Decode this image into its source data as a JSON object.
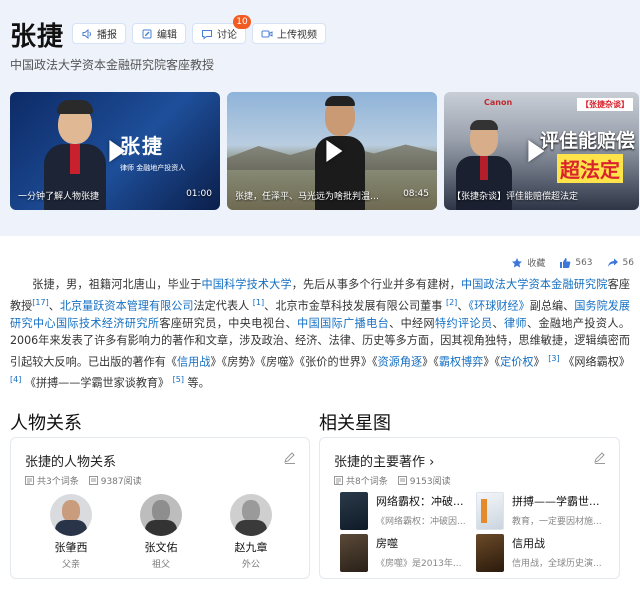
{
  "header": {
    "title": "张捷",
    "subtitle": "中国政法大学资本金融研究院客座教授",
    "actions": [
      {
        "label": "播报",
        "icon": "speaker-icon"
      },
      {
        "label": "编辑",
        "icon": "edit-icon"
      },
      {
        "label": "讨论",
        "icon": "comment-icon",
        "badge": "10"
      },
      {
        "label": "上传视频",
        "icon": "video-icon"
      }
    ]
  },
  "videos": [
    {
      "caption": "一分钟了解人物张捷",
      "duration": "01:00",
      "overlay_name": "张捷",
      "overlay_sub": "律师 金融地产投资人"
    },
    {
      "caption": "张捷，任泽平、马光远为啥批判温铁...",
      "duration": "08:45"
    },
    {
      "caption": "【张捷杂谈】评佳能赔偿超法定",
      "duration": "",
      "tag": "【张捷杂谈】",
      "headline": "评佳能赔偿",
      "highlight": "超法定",
      "logo": "Canon"
    }
  ],
  "stats": {
    "favorite_label": "收藏",
    "likes": "563",
    "shares": "56"
  },
  "summary": {
    "p1": "张捷，男，祖籍河北唐山，毕业于",
    "l1": "中国科学技术大学",
    "p2": "，先后从事多个行业并多有建树，",
    "l2": "中国政法大学资本金融研究院",
    "p3": "客座教授",
    "s1": "[17]",
    "p4": "、",
    "l3": "北京量跃资本管理有限公司",
    "p5": "法定代表人",
    "s2": "[1]",
    "p6": "、北京市金草科技发展有限公司董事",
    "s3": "[2]",
    "p7": "、",
    "l4": "《环球财经》",
    "p8": "副总编、",
    "l5": "国务院发展研究中心国际技术经济研究所",
    "p9": "客座研究员，中央电视台、",
    "l6": "中国国际广播电台",
    "p10": "、中经网",
    "l7": "特约评论员",
    "p11": "、",
    "l8": "律师",
    "p12": "、金融地产投资人。2006年来发表了许多有影响力的著作和文章，涉及政治、经济、法律、历史等多方面，因其视角独特，思维敏捷，逻辑缜密而引起较大反响。已出版的著作有《",
    "l9": "信用战",
    "p13": "》《房势》《房噬》《张价的世界》《",
    "l10": "资源角逐",
    "p14": "》《",
    "l11": "霸权博弈",
    "p15": "》《",
    "l12": "定价权",
    "p16": "》",
    "s4": "[3]",
    "p17": "《网络霸权》",
    "s5": "[4]",
    "p18": "《拼搏——学霸世家谈教育》",
    "s6": "[5]",
    "p19": "等。"
  },
  "relations": {
    "section_title": "人物关系",
    "panel_title": "张捷的人物关系",
    "count": "共3个词条",
    "reads": "9387阅读",
    "people": [
      {
        "name": "张肇西",
        "role": "父亲"
      },
      {
        "name": "张文佑",
        "role": "祖父"
      },
      {
        "name": "赵九章",
        "role": "外公"
      }
    ]
  },
  "works": {
    "section_title": "相关星图",
    "panel_title": "张捷的主要著作",
    "count": "共8个词条",
    "reads": "9153阅读",
    "items": [
      {
        "title": "网络霸权：冲破...",
        "desc": "《网络霸权：冲破因...",
        "cover_color": "#2b3a4a"
      },
      {
        "title": "拼搏——学霸世...",
        "desc": "教育，一定要因材施...",
        "cover_color": "#e9eef3"
      },
      {
        "title": "房噬",
        "desc": "《房噬》是2013年...",
        "cover_color": "#3a3026"
      },
      {
        "title": "信用战",
        "desc": "信用战，全球历史演...",
        "cover_color": "#4a3420"
      }
    ]
  }
}
